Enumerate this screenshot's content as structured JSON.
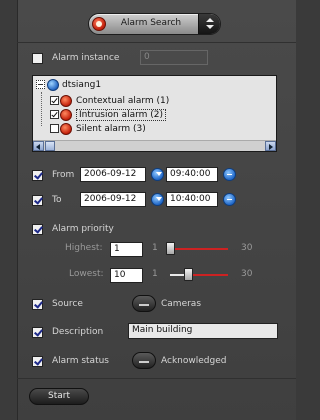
{
  "mode_select": {
    "label": "Alarm Search"
  },
  "alarm_instance": {
    "label": "Alarm instance",
    "checked": false,
    "value": "0"
  },
  "tree": {
    "root": "dtsiang1",
    "items": [
      {
        "label": "Contextual alarm (1)",
        "checked": true
      },
      {
        "label": "Intrusion alarm (2)",
        "checked": true,
        "selected": true
      },
      {
        "label": "Silent alarm (3)",
        "checked": false
      }
    ]
  },
  "from": {
    "label": "From",
    "checked": true,
    "date": "2006-09-12",
    "time": "09:40:00"
  },
  "to": {
    "label": "To",
    "checked": true,
    "date": "2006-09-12",
    "time": "10:40:00"
  },
  "priority": {
    "label": "Alarm priority",
    "checked": true,
    "highest": {
      "label": "Highest:",
      "value": "1",
      "min": "1",
      "max": "30",
      "level": 1
    },
    "lowest": {
      "label": "Lowest:",
      "value": "10",
      "min": "1",
      "max": "30",
      "level": 10
    }
  },
  "source": {
    "label": "Source",
    "checked": true,
    "button": "Cameras"
  },
  "description": {
    "label": "Description",
    "checked": true,
    "value": "Main building"
  },
  "alarm_status": {
    "label": "Alarm status",
    "checked": true,
    "button": "Acknowledged"
  },
  "start_button": "Start",
  "colors": {
    "accent_red": "#c22",
    "accent_blue": "#2168c8"
  }
}
